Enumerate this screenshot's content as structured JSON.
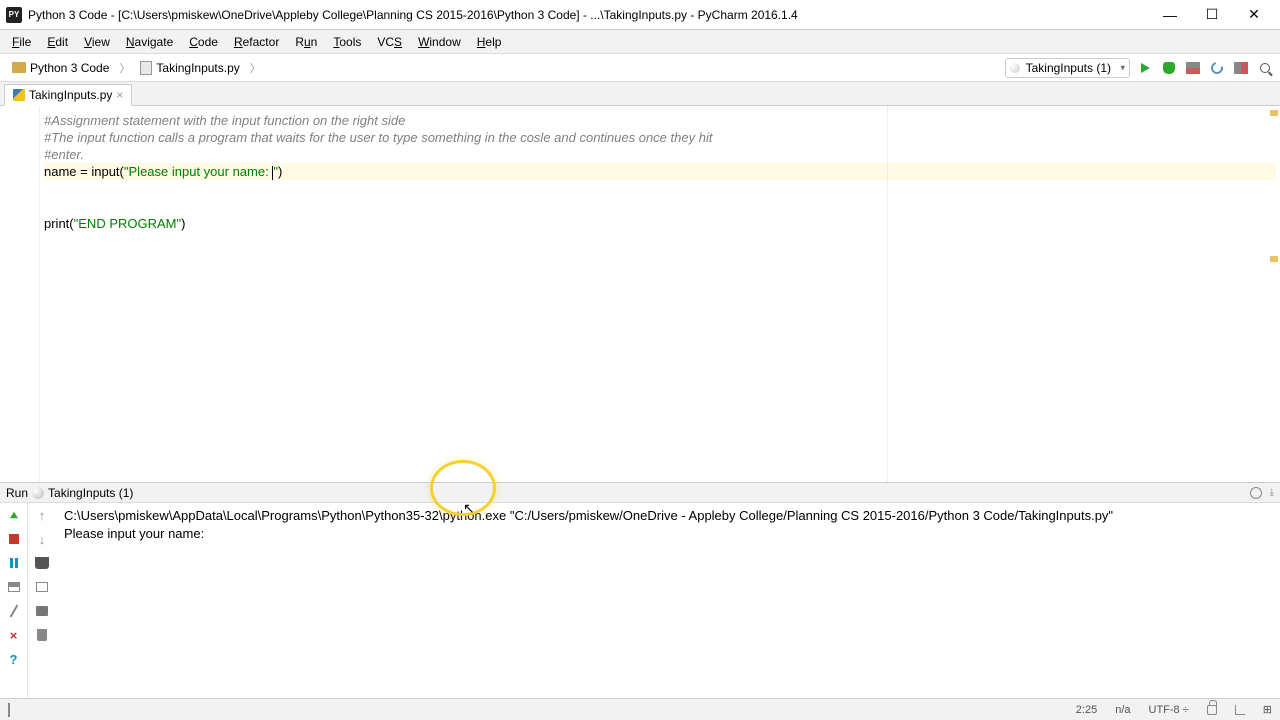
{
  "titlebar": {
    "app_label": "PY",
    "title": "Python 3 Code - [C:\\Users\\pmiskew\\OneDrive\\Appleby College\\Planning CS 2015-2016\\Python 3 Code] - ...\\TakingInputs.py - PyCharm 2016.1.4"
  },
  "menubar": {
    "items": [
      "File",
      "Edit",
      "View",
      "Navigate",
      "Code",
      "Refactor",
      "Run",
      "Tools",
      "VCS",
      "Window",
      "Help"
    ]
  },
  "breadcrumb": {
    "root": "Python 3 Code",
    "file": "TakingInputs.py"
  },
  "run_config": {
    "selected": "TakingInputs (1)"
  },
  "tabs": {
    "active": "TakingInputs.py"
  },
  "editor": {
    "line1": "#Assignment statement with the input function on the right side",
    "line2": "#The input function calls a program that waits for the user to type something in the cosle and continues once they hit",
    "line3": "#enter.",
    "line4_pre": "name = ",
    "line4_fn": "input",
    "line4_paren_open": "(",
    "line4_str": "\"Please input your name: ",
    "line4_str_end": "\"",
    "line4_paren_close": ")",
    "line6_fn": "print",
    "line6_paren_open": "(",
    "line6_str": "\"END PROGRAM\"",
    "line6_paren_close": ")"
  },
  "run_panel": {
    "header_label": "Run",
    "config_name": "TakingInputs (1)",
    "console_line1": "C:\\Users\\pmiskew\\AppData\\Local\\Programs\\Python\\Python35-32\\python.exe \"C:/Users/pmiskew/OneDrive - Appleby College/Planning CS 2015-2016/Python 3 Code/TakingInputs.py\"",
    "console_line2": "Please input your name: "
  },
  "statusbar": {
    "col": "2:25",
    "na": "n/a",
    "encoding": "UTF-8",
    "branch_sep": "÷"
  }
}
